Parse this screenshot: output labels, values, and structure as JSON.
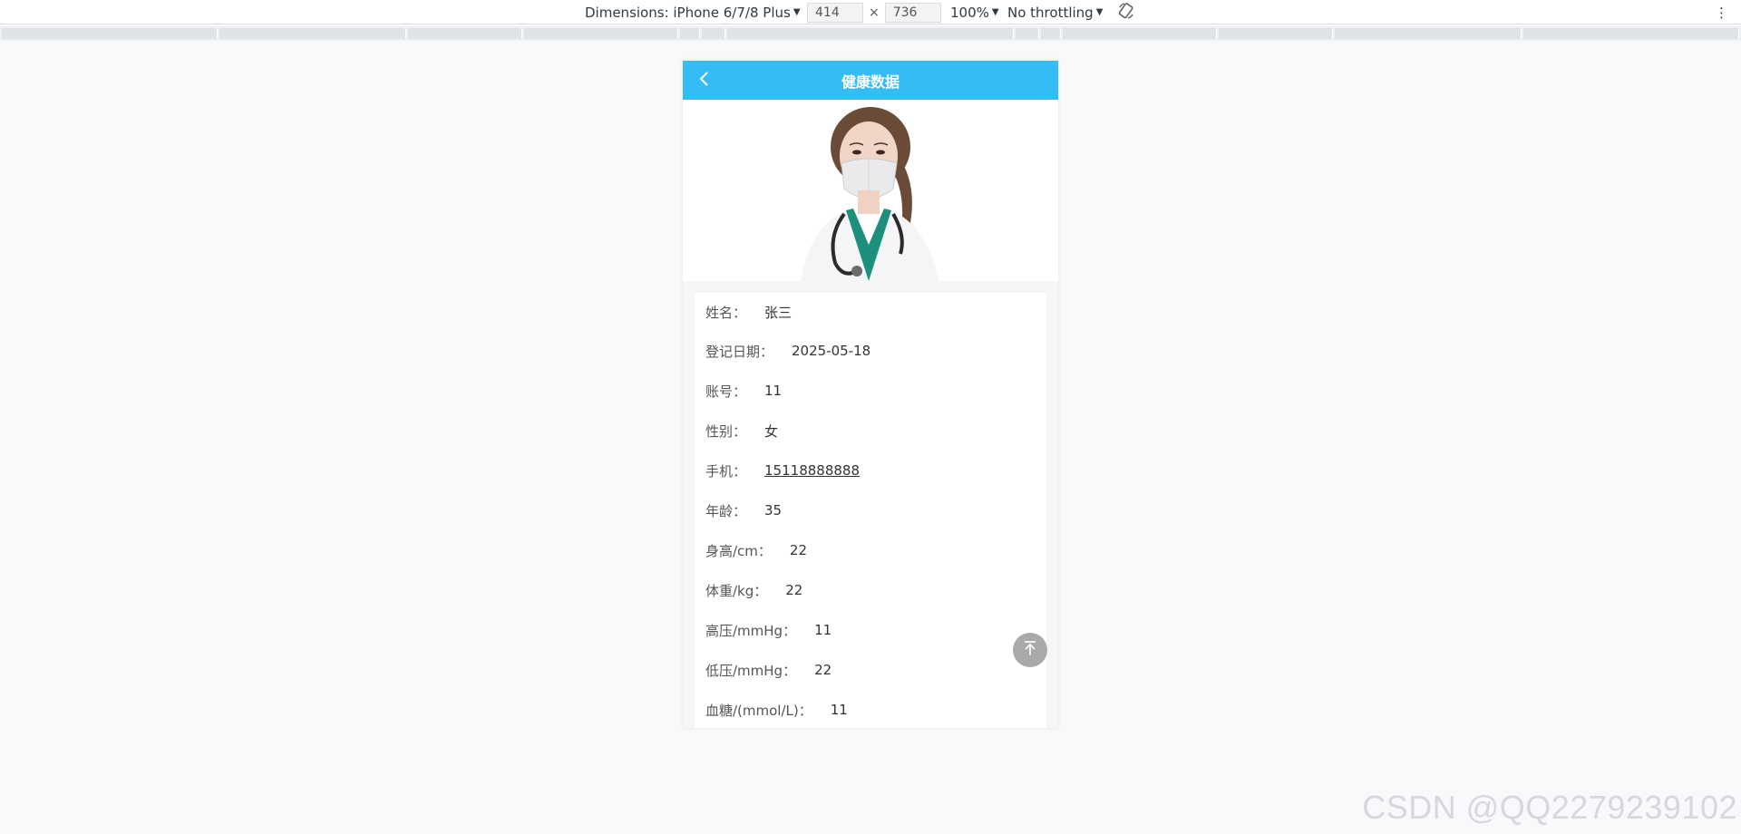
{
  "devtools": {
    "device_label": "Dimensions: iPhone 6/7/8 Plus",
    "width": "414",
    "times": "×",
    "height": "736",
    "zoom": "100%",
    "throttling": "No throttling",
    "more_icon": "⋮",
    "rotate_icon": "rotate-icon"
  },
  "app": {
    "title": "健康数据",
    "rows": [
      {
        "label": "姓名：",
        "value": "张三"
      },
      {
        "label": "登记日期：",
        "value": "2025-05-18"
      },
      {
        "label": "账号：",
        "value": "11"
      },
      {
        "label": "性别：",
        "value": "女"
      },
      {
        "label": "手机：",
        "value": "15118888888"
      },
      {
        "label": "年龄：",
        "value": "35"
      },
      {
        "label": "身高/cm：",
        "value": "22"
      },
      {
        "label": "体重/kg：",
        "value": "22"
      },
      {
        "label": "高压/mmHg：",
        "value": "11"
      },
      {
        "label": "低压/mmHg：",
        "value": "22"
      },
      {
        "label": "血糖/(mmol/L)：",
        "value": "11"
      }
    ]
  },
  "watermark": "CSDN @QQ2279239102",
  "colors": {
    "header": "#33bdf4",
    "back_top": "#a9a9a9"
  }
}
